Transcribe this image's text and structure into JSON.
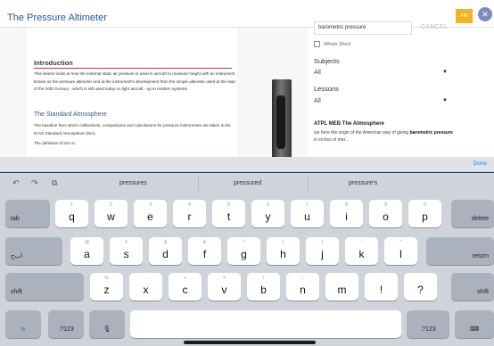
{
  "app": {
    "title": "The Pressure Altimeter",
    "accent_color": "#1d5a9a"
  },
  "document": {
    "heading": "Introduction",
    "intro_text": "This lesson looks at how the external static air pressure is used in aircraft to measure height with an instrument known as the pressure altimeter and at the instrument's development from the simple altimeter used at the start of the 20th Century - which is still used today on light aircraft - up to modern systems.",
    "subheading": "The Standard Atmosphere",
    "standard_text": "The baseline from which calibrations, comparisons and calculations for pressure instruments are taken is the ICAO Standard Atmosphere (ISA).",
    "isa_text": "The definition of ISA is:"
  },
  "search": {
    "value": "barometric pressure",
    "cancel_label": "CANCEL",
    "fw_label": "FW",
    "close_glyph": "✕",
    "whole_word_label": "Whole Word",
    "subjects_label": "Subjects",
    "subjects_value": "All",
    "lessons_label": "Lessons",
    "lessons_value": "All",
    "result_title": "ATPL MEB The Atmosphere",
    "result_prefix": "ise here the origin of the American way of giving ",
    "result_highlight": "barometric pressure",
    "result_suffix": " in inches of mer..."
  },
  "keyboard": {
    "done_label": "Done",
    "predictions": [
      "pressures",
      "pressured",
      "pressure's"
    ],
    "tools": [
      "↶",
      "↷",
      "⧉"
    ],
    "row1": [
      [
        "q",
        "1"
      ],
      [
        "w",
        "2"
      ],
      [
        "e",
        "3"
      ],
      [
        "r",
        "4"
      ],
      [
        "t",
        "5"
      ],
      [
        "y",
        "6"
      ],
      [
        "u",
        "7"
      ],
      [
        "i",
        "8"
      ],
      [
        "o",
        "9"
      ],
      [
        "p",
        "0"
      ]
    ],
    "row2": [
      [
        "a",
        "@"
      ],
      [
        "s",
        "#"
      ],
      [
        "d",
        "$"
      ],
      [
        "f",
        "&"
      ],
      [
        "g",
        "*"
      ],
      [
        "h",
        "("
      ],
      [
        "j",
        ")"
      ],
      [
        "k",
        "'"
      ],
      [
        "l",
        "\""
      ]
    ],
    "row3": [
      [
        "z",
        "%"
      ],
      [
        "x",
        "-"
      ],
      [
        "c",
        "+"
      ],
      [
        "v",
        "="
      ],
      [
        "b",
        "/"
      ],
      [
        "n",
        ";"
      ],
      [
        "m",
        ":"
      ],
      [
        "!",
        ","
      ],
      [
        "?",
        "."
      ]
    ],
    "tab_label": "tab",
    "delete_label": "delete",
    "lang_label": "اب‌ج",
    "return_label": "return",
    "shift_label": "shift",
    "num_label": ".?123",
    "emoji_glyph": "☺",
    "mic_glyph": "🎙",
    "hide_glyph": "⌨"
  }
}
